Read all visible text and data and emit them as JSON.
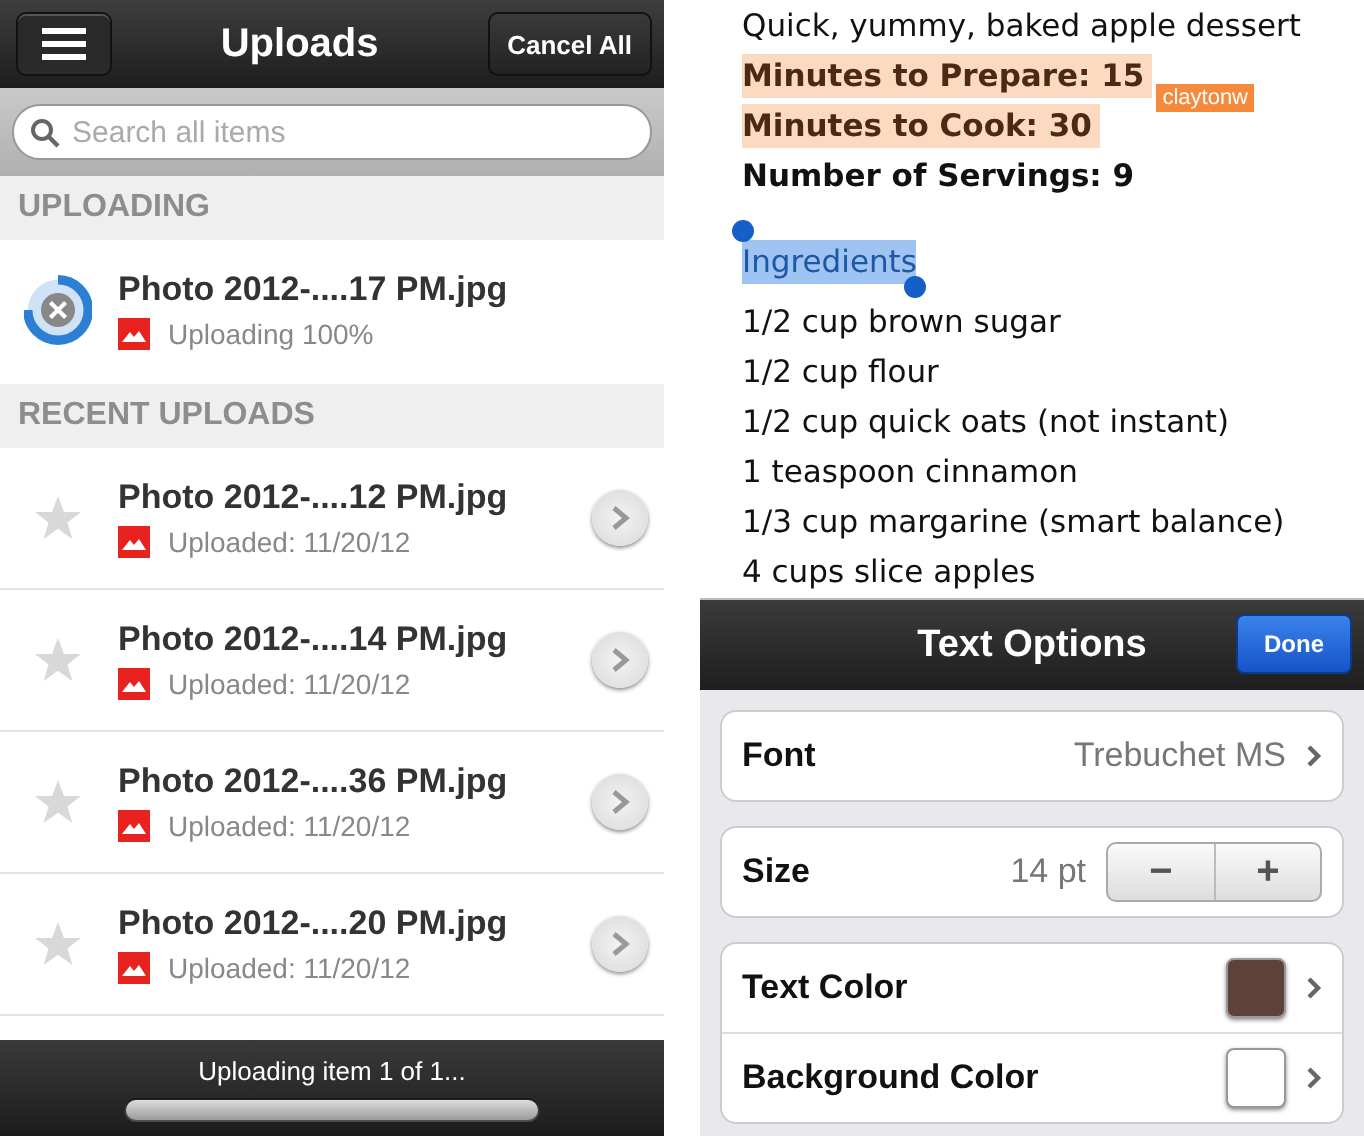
{
  "uploads": {
    "title": "Uploads",
    "cancel_button": "Cancel All",
    "search": {
      "placeholder": "Search all items"
    },
    "sections": [
      {
        "heading": "UPLOADING",
        "items": [
          {
            "kind": "uploading",
            "name": "Photo 2012-....17 PM.jpg",
            "status": "Uploading 100%"
          }
        ]
      },
      {
        "heading": "RECENT UPLOADS",
        "items": [
          {
            "kind": "uploaded",
            "name": "Photo 2012-....12 PM.jpg",
            "status": "Uploaded: 11/20/12",
            "starred": false
          },
          {
            "kind": "uploaded",
            "name": "Photo 2012-....14 PM.jpg",
            "status": "Uploaded: 11/20/12",
            "starred": false
          },
          {
            "kind": "uploaded",
            "name": "Photo 2012-....36 PM.jpg",
            "status": "Uploaded: 11/20/12",
            "starred": false
          },
          {
            "kind": "uploaded",
            "name": "Photo 2012-....20 PM.jpg",
            "status": "Uploaded: 11/20/12",
            "starred": false
          }
        ]
      }
    ],
    "status_bar": {
      "text": "Uploading item 1 of 1...",
      "level": 1
    }
  },
  "document": {
    "lines": [
      {
        "text": "Quick, yummy, baked apple dessert",
        "bold": false,
        "highlighted": false,
        "selected": false
      },
      {
        "text": "Minutes to Prepare: 15",
        "bold": true,
        "highlighted": true,
        "selected": false,
        "tag": "claytonw"
      },
      {
        "text": "Minutes to Cook: 30",
        "bold": true,
        "highlighted": true,
        "selected": false
      },
      {
        "text": "Number of Servings: 9",
        "bold": true,
        "highlighted": false,
        "selected": false
      },
      {
        "text": "Ingredients",
        "bold": false,
        "highlighted": false,
        "selected": true
      },
      {
        "text": "1/2 cup brown sugar",
        "bold": false,
        "highlighted": false,
        "selected": false
      },
      {
        "text": "1/2 cup flour",
        "bold": false,
        "highlighted": false,
        "selected": false
      },
      {
        "text": "1/2 cup quick oats (not instant)",
        "bold": false,
        "highlighted": false,
        "selected": false
      },
      {
        "text": "1 teaspoon cinnamon",
        "bold": false,
        "highlighted": false,
        "selected": false
      },
      {
        "text": "1/3 cup margarine (smart balance)",
        "bold": false,
        "highlighted": false,
        "selected": false
      },
      {
        "text": "4 cups slice apples",
        "bold": false,
        "highlighted": false,
        "selected": false
      }
    ]
  },
  "text_options": {
    "title": "Text Options",
    "done_button": "Done",
    "font": {
      "label": "Font",
      "value": "Trebuchet MS"
    },
    "size": {
      "label": "Size",
      "value": "14 pt",
      "minus": "−",
      "plus": "+"
    },
    "colors": [
      {
        "label": "Text Color",
        "color": "#5e4239"
      },
      {
        "label": "Background Color",
        "color": "#ffffff"
      }
    ]
  }
}
